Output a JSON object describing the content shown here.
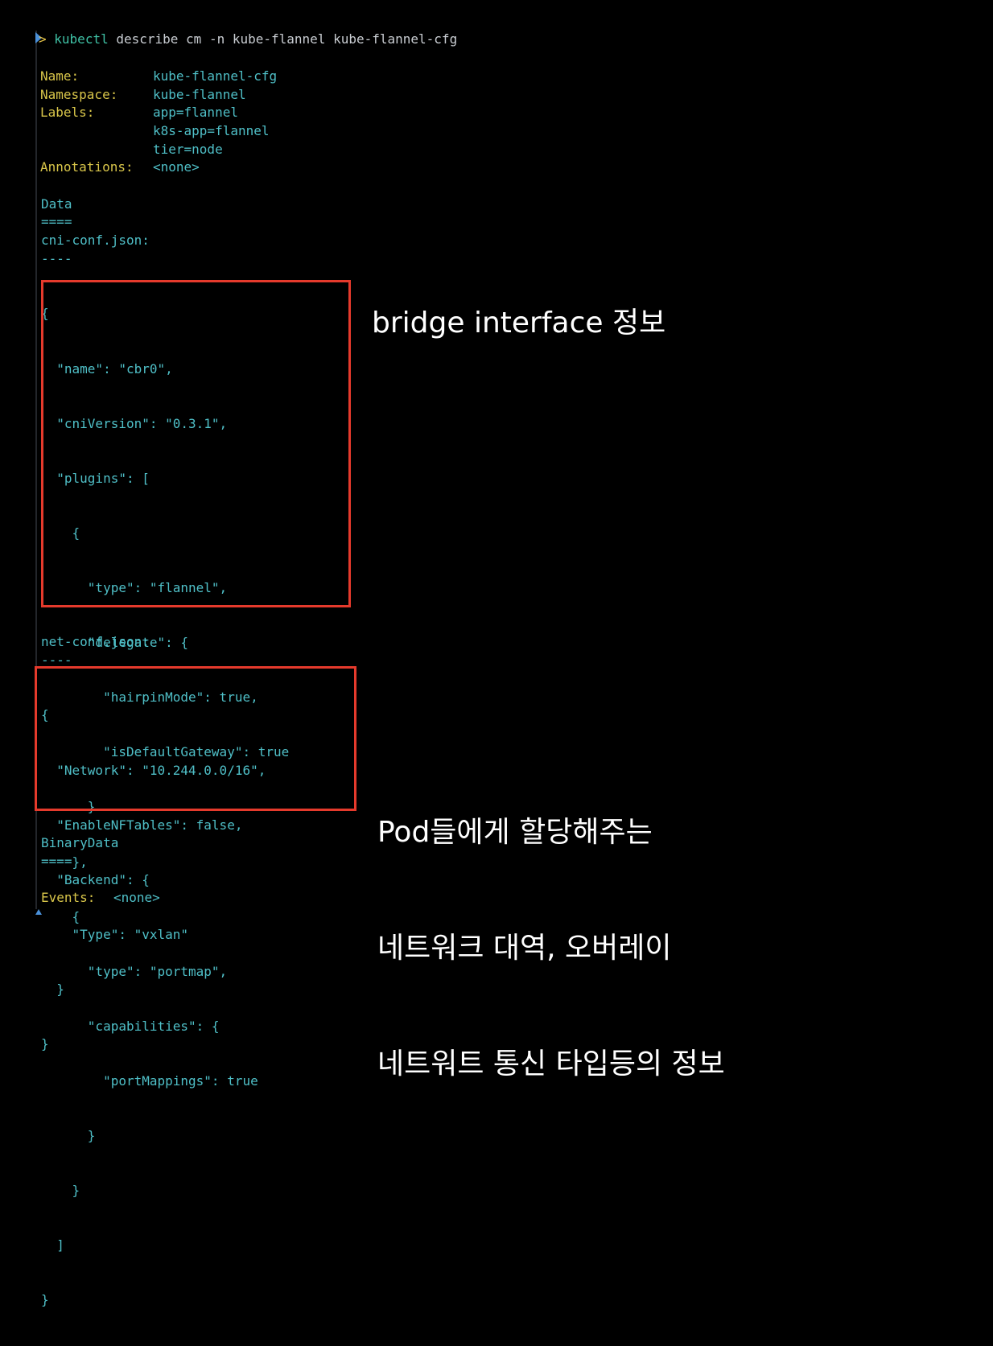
{
  "terminal": {
    "prompt": ">",
    "command_name": "kubectl",
    "command_args": " describe cm -n kube-flannel kube-flannel-cfg"
  },
  "meta": {
    "name_key": "Name:",
    "name_val": "kube-flannel-cfg",
    "namespace_key": "Namespace:",
    "namespace_val": "kube-flannel",
    "labels_key": "Labels:",
    "labels": [
      "app=flannel",
      "k8s-app=flannel",
      "tier=node"
    ],
    "annotations_key": "Annotations:",
    "annotations_val": "<none>"
  },
  "data_section": {
    "title": "Data",
    "underline": "====",
    "cni_key": "cni-conf.json:",
    "cni_underline": "----",
    "cni_lines": [
      "{",
      "  \"name\": \"cbr0\",",
      "  \"cniVersion\": \"0.3.1\",",
      "  \"plugins\": [",
      "    {",
      "      \"type\": \"flannel\",",
      "      \"delegate\": {",
      "        \"hairpinMode\": true,",
      "        \"isDefaultGateway\": true",
      "      }",
      "    },",
      "    {",
      "      \"type\": \"portmap\",",
      "      \"capabilities\": {",
      "        \"portMappings\": true",
      "      }",
      "    }",
      "  ]",
      "}"
    ],
    "net_key": "net-conf.json:",
    "net_underline": "----",
    "net_lines": [
      "{",
      "  \"Network\": \"10.244.0.0/16\",",
      "  \"EnableNFTables\": false,",
      "  \"Backend\": {",
      "    \"Type\": \"vxlan\"",
      "  }",
      "}"
    ]
  },
  "binary_section": {
    "title": "BinaryData",
    "underline": "===="
  },
  "events": {
    "key": "Events:",
    "val": "<none>"
  },
  "annotations": {
    "bridge_note": "bridge interface 정보",
    "pod_note_lines": [
      "Pod들에게 할당해주는",
      "네트워크 대역, 오버레이",
      "네트워트 통신 타입등의 정보"
    ]
  },
  "colors": {
    "highlight_box": "#e53a2c",
    "key_yellow": "#d9c64a",
    "value_cyan": "#4fbfc7",
    "background": "#000000"
  }
}
